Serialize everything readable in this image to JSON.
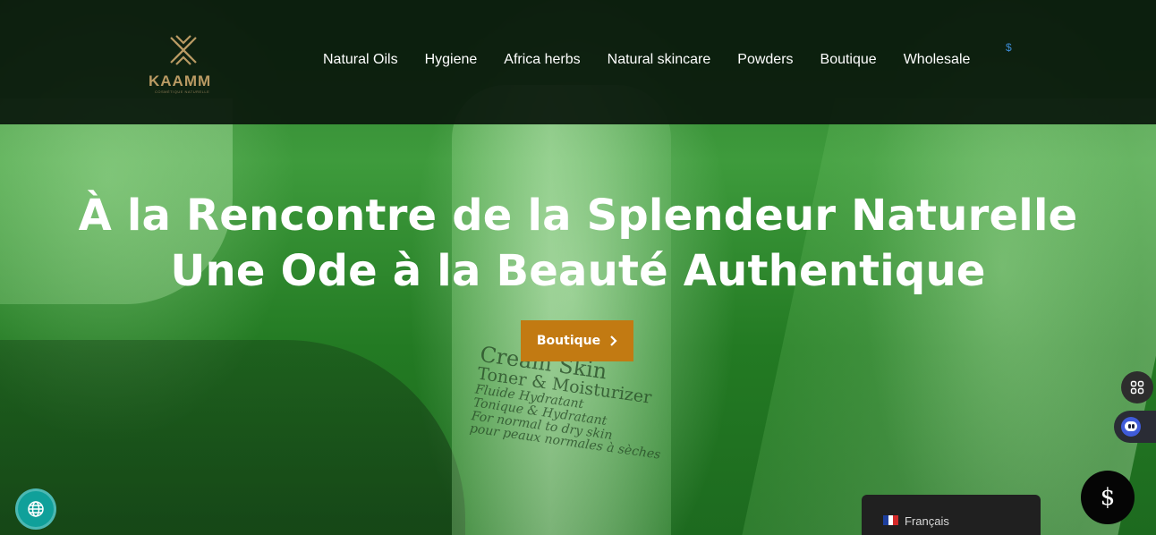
{
  "header": {
    "logo": {
      "brand": "KAAMM",
      "tagline": "COSMÉTIQUE NATURELLE"
    },
    "nav": [
      {
        "label": "Natural Oils"
      },
      {
        "label": "Hygiene"
      },
      {
        "label": "Africa herbs"
      },
      {
        "label": "Natural skincare"
      },
      {
        "label": "Powders"
      },
      {
        "label": "Boutique"
      },
      {
        "label": "Wholesale"
      }
    ],
    "currency_symbol": "$"
  },
  "hero": {
    "title_line1": "À la Rencontre de la Splendeur Naturelle",
    "title_line2": "Une Ode à la Beauté Authentique",
    "cta_label": "Boutique",
    "bottle_text": {
      "line1": "Cream Skin",
      "line2": "Toner & Moisturizer",
      "line3": "Fluide Hydratant",
      "line4": "Tonique & Hydratant",
      "line5": "For normal to dry skin",
      "line6": "pour peaux normales à sèches"
    }
  },
  "widgets": {
    "currency_button": "$",
    "language": "Français",
    "colors": {
      "cta": "#c27a12",
      "header_bg": "#0a180c",
      "globe": "#10a09a",
      "chatbot": "#3f5bd9"
    }
  }
}
